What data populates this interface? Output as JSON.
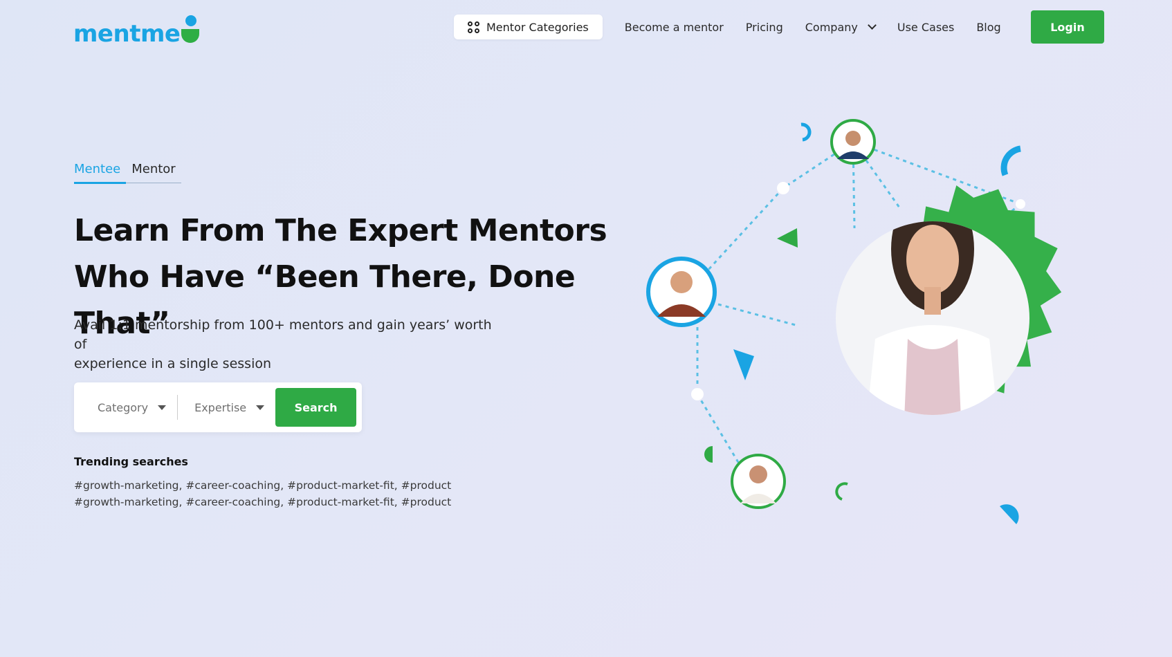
{
  "header": {
    "logo_text": "mentme",
    "nav": {
      "mentor_categories": "Mentor Categories",
      "become_mentor": "Become a mentor",
      "pricing": "Pricing",
      "company": "Company",
      "use_cases": "Use Cases",
      "blog": "Blog"
    },
    "login_label": "Login"
  },
  "hero": {
    "tabs": [
      {
        "label": "Mentee",
        "active": true
      },
      {
        "label": "Mentor",
        "active": false
      }
    ],
    "headline_line1": "Learn From The Expert Mentors",
    "headline_line2": "Who Have “Been There, Done That”",
    "subtext_line1": "Avail 1:1 mentorship from 100+ mentors and gain years’ worth of",
    "subtext_line2": "experience in a single session",
    "search": {
      "category_label": "Category",
      "expertise_label": "Expertise",
      "button_label": "Search"
    },
    "trending": {
      "title": "Trending searches",
      "lines": [
        [
          "#growth-marketing,",
          "#career-coaching,",
          "#product-market-fit,",
          "#product"
        ],
        [
          "#growth-marketing,",
          "#career-coaching,",
          "#product-market-fit,",
          "#product"
        ]
      ]
    }
  },
  "colors": {
    "brand_blue": "#1aa4e3",
    "brand_green": "#2faa45",
    "background": "#e1e6f6"
  },
  "icons": [
    "grid-icon",
    "chevron-down-icon",
    "caret-down-icon"
  ]
}
